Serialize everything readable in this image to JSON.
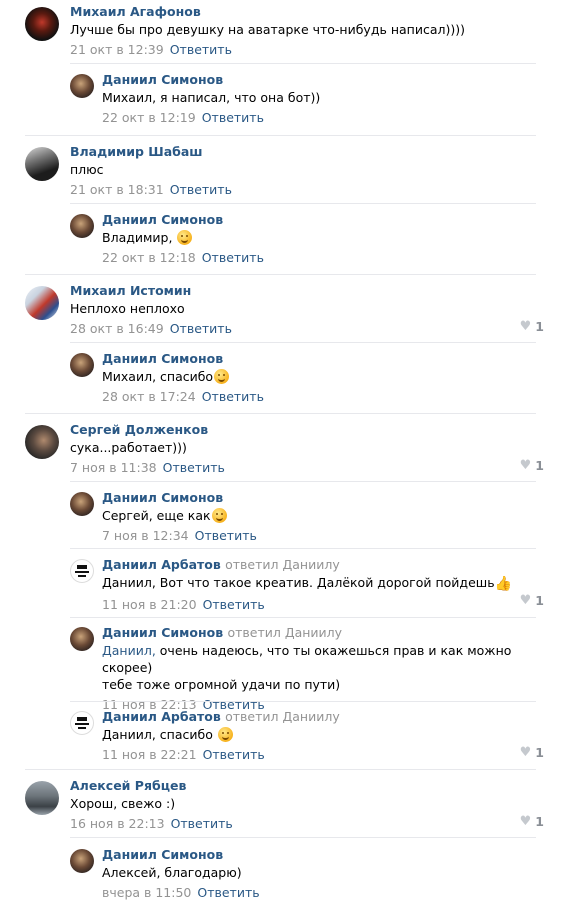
{
  "reply_label": "Ответить",
  "comments": [
    {
      "author": "Михаил Агафонов",
      "text": "Лучше бы про девушку на аватарке что-нибудь написал))))",
      "time": "21 окт в 12:39"
    },
    {
      "author": "Даниил Симонов",
      "text": "Михаил, я написал, что она бот))",
      "time": "22 окт в 12:19"
    },
    {
      "author": "Владимир Шабаш",
      "text": "плюс",
      "time": "21 окт в 18:31"
    },
    {
      "author": "Даниил Симонов",
      "text": "Владимир,",
      "time": "22 окт в 12:18"
    },
    {
      "author": "Михаил Истомин",
      "text": "Неплохо неплохо",
      "time": "28 окт в 16:49",
      "likes": "1"
    },
    {
      "author": "Даниил Симонов",
      "text": "Михаил, спасибо",
      "time": "28 окт в 17:24"
    },
    {
      "author": "Сергей Долженков",
      "text": "сука...работает)))",
      "time": "7 ноя в 11:38",
      "likes": "1"
    },
    {
      "author": "Даниил Симонов",
      "text": "Сергей, еще как",
      "time": "7 ноя в 12:34"
    },
    {
      "author": "Даниил Арбатов",
      "replied": "ответил Даниилу",
      "text": "Даниил, Вот что такое креатив. Далёкой дорогой пойдешь",
      "time": "11 ноя в 21:20",
      "likes": "1"
    },
    {
      "author": "Даниил Симонов",
      "replied": "ответил Даниилу",
      "mention": "Даниил,",
      "text": " очень надеюсь, что ты окажешься прав и как можно скорее)",
      "text2": "тебе тоже огромной удачи по пути)",
      "time": "11 ноя в 22:13"
    },
    {
      "author": "Даниил Арбатов",
      "replied": "ответил Даниилу",
      "text": "Даниил, спасибо",
      "time": "11 ноя в 22:21",
      "likes": "1"
    },
    {
      "author": "Алексей Рябцев",
      "text": "Хорош, свежо :)",
      "time": "16 ноя в 22:13",
      "likes": "1"
    },
    {
      "author": "Даниил Симонов",
      "text": "Алексей, благодарю)",
      "time": "вчера в 11:50"
    }
  ]
}
